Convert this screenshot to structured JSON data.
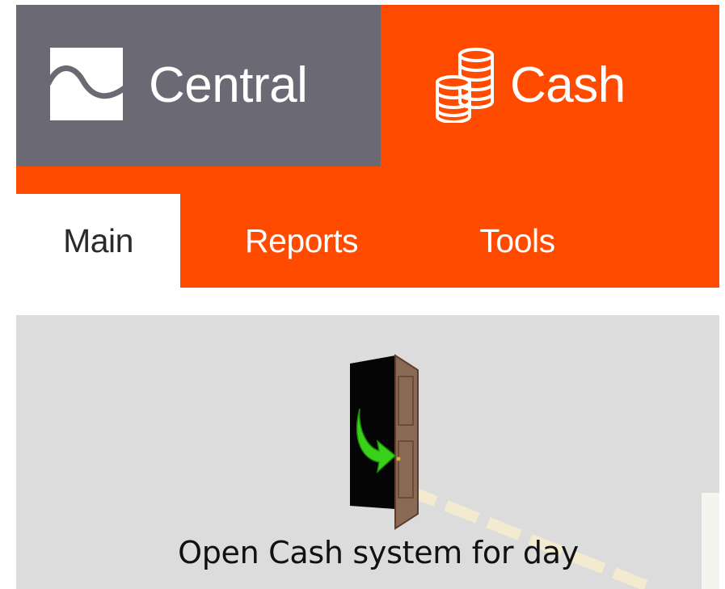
{
  "header": {
    "central": {
      "label": "Central",
      "icon": "wave-logo-icon",
      "background": "#6b6a74"
    },
    "cash": {
      "label": "Cash",
      "icon": "coins-stack-icon",
      "background": "#ff4b00"
    }
  },
  "tabs": [
    {
      "label": "Main",
      "active": true
    },
    {
      "label": "Reports",
      "active": false
    },
    {
      "label": "Tools",
      "active": false
    }
  ],
  "main": {
    "actions": [
      {
        "label": "Open Cash system for day",
        "icon": "open-door-icon"
      }
    ]
  },
  "colors": {
    "accent": "#ff4b00",
    "brand_gray": "#6b6a74",
    "panel_background": "#dcdcdc"
  }
}
